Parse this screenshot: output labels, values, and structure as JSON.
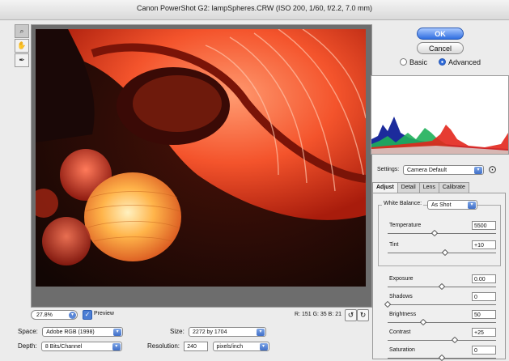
{
  "window": {
    "title": "Canon PowerShot G2:  lampSpheres.CRW  (ISO 200, 1/60, f/2.2, 7.0 mm)"
  },
  "tools": [
    {
      "name": "zoom-tool-icon",
      "glyph": "🔍"
    },
    {
      "name": "hand-tool-icon",
      "glyph": "✋"
    },
    {
      "name": "eyedropper-tool-icon",
      "glyph": "⁄"
    }
  ],
  "status": {
    "zoom": "27.8%",
    "preview_label": "Preview",
    "preview_checked": true,
    "rgb_readout": "R: 151  G:  35  B:  21"
  },
  "workflow": {
    "space_label": "Space:",
    "space_value": "Adobe RGB (1998)",
    "depth_label": "Depth:",
    "depth_value": "8 Bits/Channel",
    "size_label": "Size:",
    "size_value": "2272 by 1704",
    "resolution_label": "Resolution:",
    "resolution_value": "240",
    "resolution_unit": "pixels/inch"
  },
  "buttons": {
    "ok": "OK",
    "cancel": "Cancel"
  },
  "mode": {
    "basic": "Basic",
    "advanced": "Advanced",
    "selected": "Advanced"
  },
  "settings": {
    "label": "Settings:",
    "value": "Camera Default"
  },
  "tabs": [
    {
      "label": "Adjust",
      "selected": true
    },
    {
      "label": "Detail",
      "selected": false
    },
    {
      "label": "Lens",
      "selected": false
    },
    {
      "label": "Calibrate",
      "selected": false
    }
  ],
  "adjust": {
    "white_balance_label": "White Balance:",
    "white_balance_value": "As Shot",
    "temperature": {
      "label": "Temperature",
      "value": "5500",
      "level": 0.43
    },
    "tint": {
      "label": "Tint",
      "value": "+10",
      "level": 0.53
    },
    "exposure": {
      "label": "Exposure",
      "value": "0.00",
      "level": 0.5
    },
    "shadows": {
      "label": "Shadows",
      "value": "0",
      "level": 0.0
    },
    "brightness": {
      "label": "Brightness",
      "value": "50",
      "level": 0.33
    },
    "contrast": {
      "label": "Contrast",
      "value": "+25",
      "level": 0.62
    },
    "saturation": {
      "label": "Saturation",
      "value": "0",
      "level": 0.5
    }
  },
  "colors": {
    "accent": "#2f6ee0",
    "lantern": "#e8442a"
  }
}
